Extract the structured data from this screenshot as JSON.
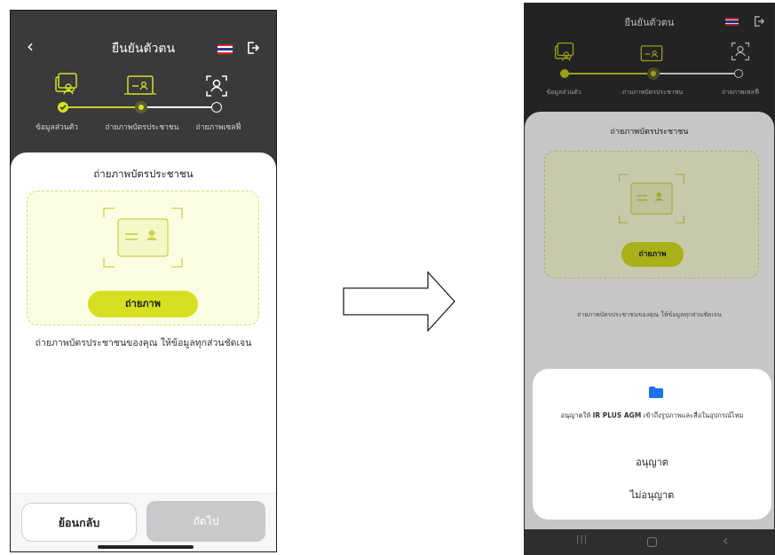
{
  "left_screen": {
    "header": {
      "title": "ยืนยันตัวตน"
    },
    "steps": [
      {
        "label": "ข้อมูลส่วนตัว",
        "state": "done"
      },
      {
        "label": "ถ่ายภาพบัตรประชาชน",
        "state": "current"
      },
      {
        "label": "ถ่ายภาพเซลฟี่",
        "state": "pending"
      }
    ],
    "sheet": {
      "title": "ถ่ายภาพบัตรประชาชน",
      "capture_label": "ถ่ายภาพ",
      "instruction": "ถ่ายภาพบัตรประชาชนของคุณ ให้ข้อมูลทุกส่วนชัดเจน"
    },
    "footer": {
      "back_label": "ย้อนกลับ",
      "next_label": "ถัดไป"
    }
  },
  "right_screen": {
    "header": {
      "title": "ยืนยันตัวตน"
    },
    "steps": [
      {
        "label": "ข้อมูลส่วนตัว"
      },
      {
        "label": "ถ่ายภาพบัตรประชาชน"
      },
      {
        "label": "ถ่ายภาพเซลฟี่"
      }
    ],
    "sheet": {
      "title": "ถ่ายภาพบัตรประชาชน",
      "capture_label": "ถ่ายภาพ",
      "instruction": "ถ่ายภาพบัตรประชาชนของคุณ ให้ข้อมูลทุกส่วนชัดเจน"
    },
    "permission_dialog": {
      "message_prefix": "อนุญาตให้ ",
      "app_name": "IR PLUS AGM",
      "message_suffix": " เข้าถึงรูปภาพและสื่อในอุปกรณ์ไหม",
      "allow_label": "อนุญาต",
      "deny_label": "ไม่อนุญาต",
      "icon": "folder-icon"
    },
    "nav_bar": {
      "icons": [
        "recent-apps-icon",
        "home-icon",
        "back-icon"
      ]
    }
  },
  "colors": {
    "accent": "#d6e021",
    "header_bg": "#3a3a3c",
    "step_line": "#c5cf2a",
    "folder": "#1a73e8",
    "flag_red": "#d3262b",
    "flag_blue": "#2b3a8f"
  }
}
